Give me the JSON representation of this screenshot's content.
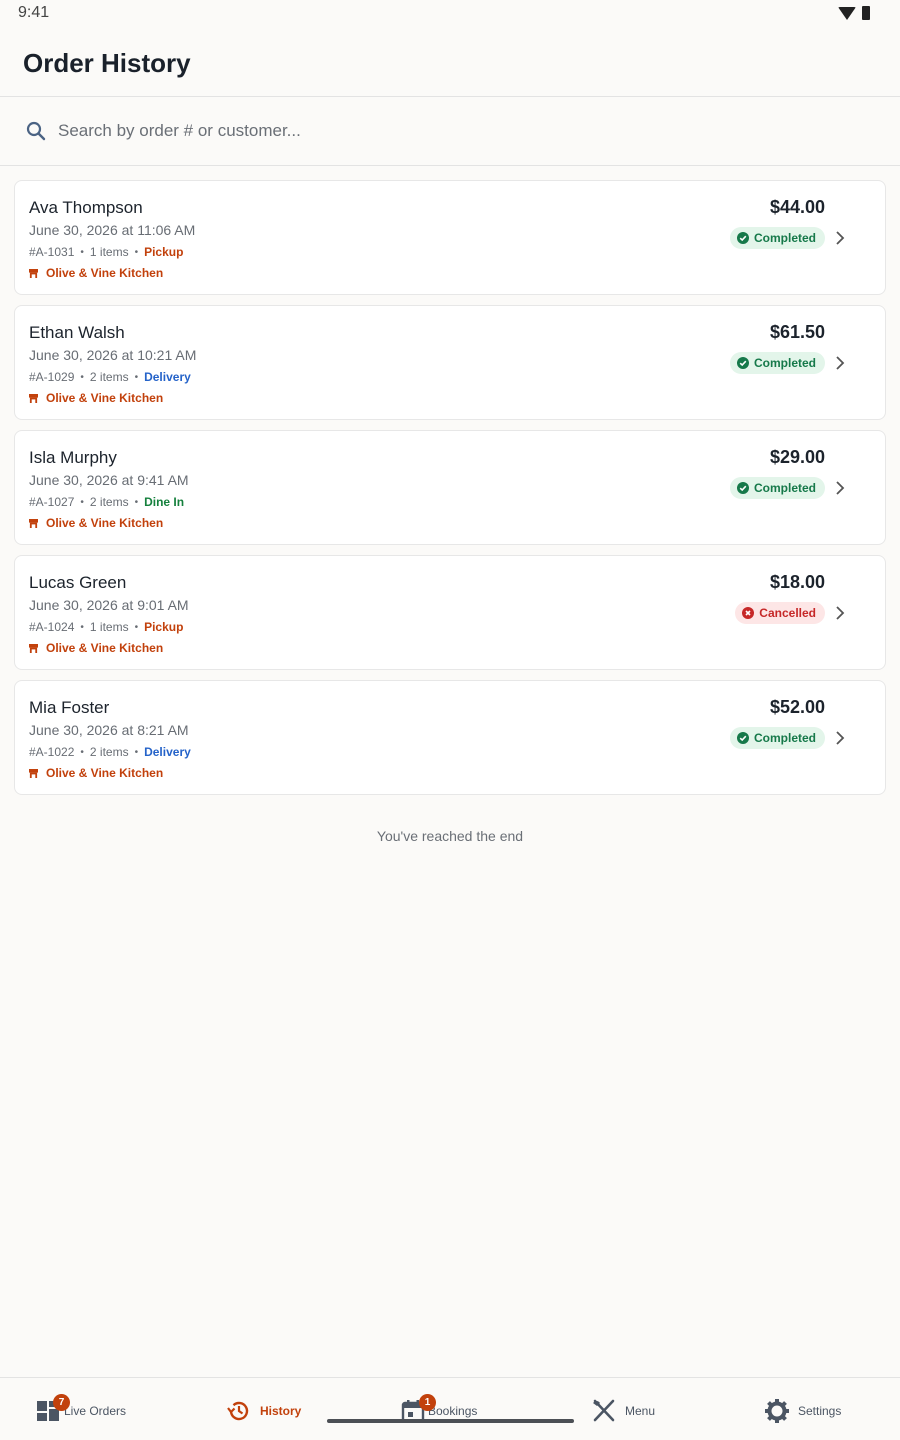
{
  "status_bar": {
    "time": "9:41"
  },
  "header": {
    "title": "Order History"
  },
  "search": {
    "placeholder": "Search by order # or customer..."
  },
  "orders": [
    {
      "customer": "Ava Thompson",
      "datetime": "June 30, 2026 at 11:06 AM",
      "order_no": "#A-1031",
      "items": "1 items",
      "type": "Pickup",
      "restaurant": "Olive & Vine Kitchen",
      "amount": "$44.00",
      "status": "Completed"
    },
    {
      "customer": "Ethan Walsh",
      "datetime": "June 30, 2026 at 10:21 AM",
      "order_no": "#A-1029",
      "items": "2 items",
      "type": "Delivery",
      "restaurant": "Olive & Vine Kitchen",
      "amount": "$61.50",
      "status": "Completed"
    },
    {
      "customer": "Isla Murphy",
      "datetime": "June 30, 2026 at 9:41 AM",
      "order_no": "#A-1027",
      "items": "2 items",
      "type": "Dine In",
      "restaurant": "Olive & Vine Kitchen",
      "amount": "$29.00",
      "status": "Completed"
    },
    {
      "customer": "Lucas Green",
      "datetime": "June 30, 2026 at 9:01 AM",
      "order_no": "#A-1024",
      "items": "1 items",
      "type": "Pickup",
      "restaurant": "Olive & Vine Kitchen",
      "amount": "$18.00",
      "status": "Cancelled"
    },
    {
      "customer": "Mia Foster",
      "datetime": "June 30, 2026 at 8:21 AM",
      "order_no": "#A-1022",
      "items": "2 items",
      "type": "Delivery",
      "restaurant": "Olive & Vine Kitchen",
      "amount": "$52.00",
      "status": "Completed"
    }
  ],
  "end_note": "You've reached the end",
  "tabs": [
    {
      "label": "Live Orders",
      "icon": "dashboard-icon",
      "badge": "7"
    },
    {
      "label": "History",
      "icon": "history-icon",
      "active": true
    },
    {
      "label": "Bookings",
      "icon": "calendar-icon",
      "badge": "1"
    },
    {
      "label": "Menu",
      "icon": "utensils-icon"
    },
    {
      "label": "Settings",
      "icon": "gear-icon"
    }
  ],
  "colors": {
    "accent": "#c2410c",
    "pickup": "#c2410c",
    "delivery": "#2563c9",
    "dine_in": "#15803d",
    "completed": "#16794a",
    "cancelled": "#c62828"
  }
}
